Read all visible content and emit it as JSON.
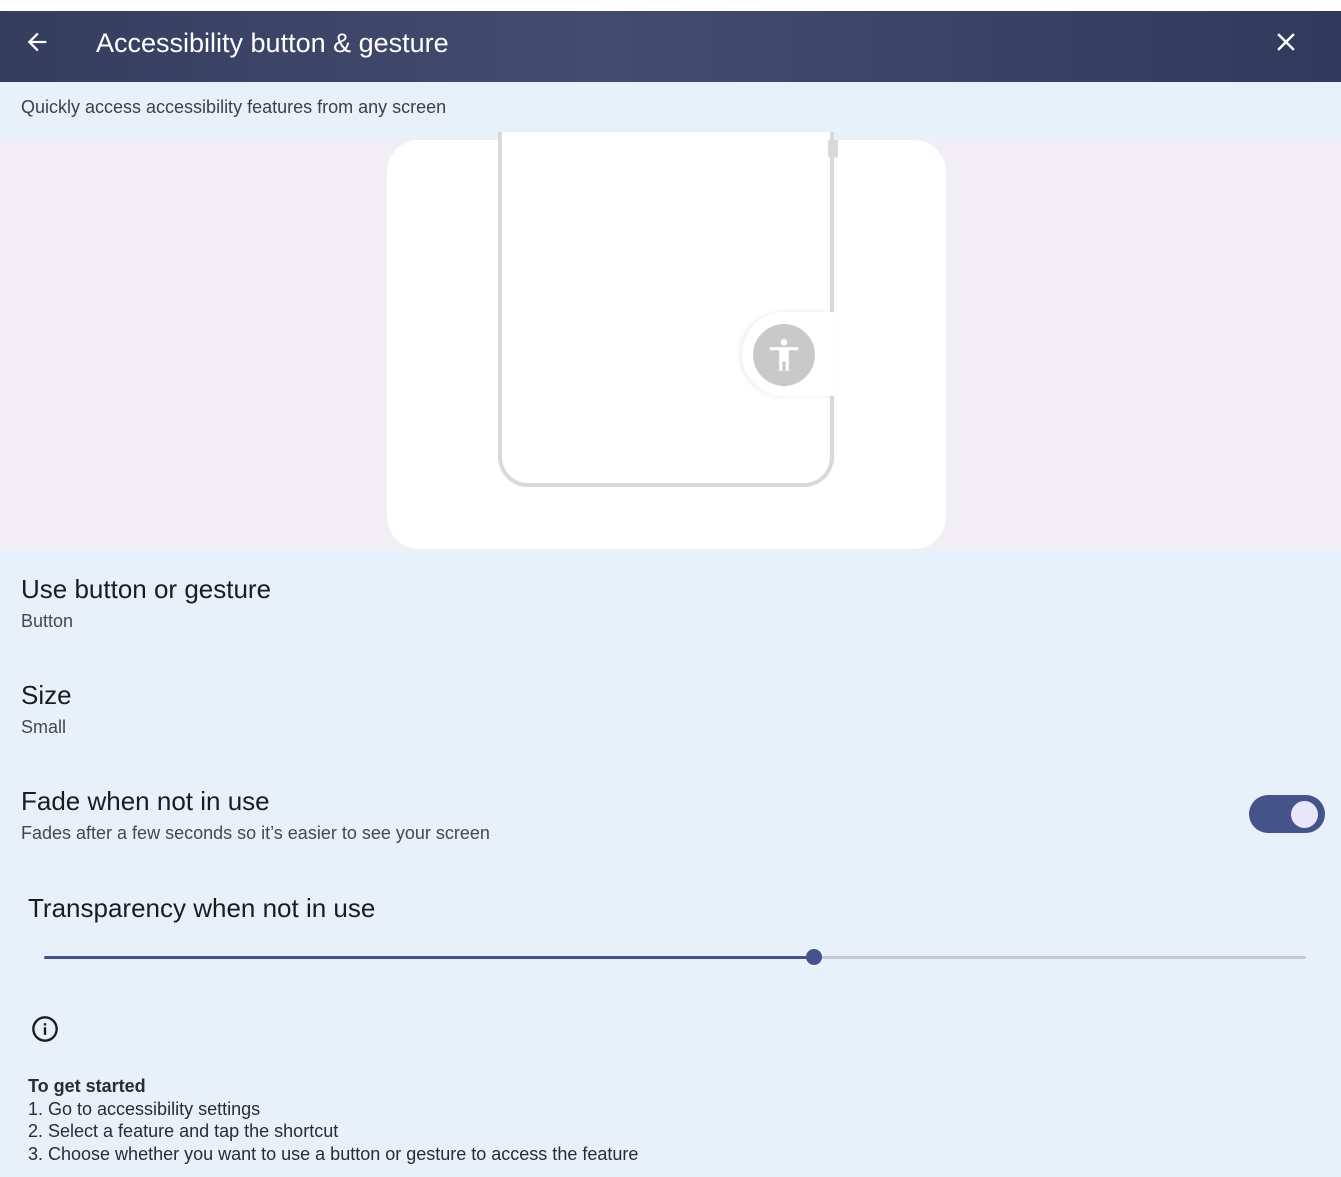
{
  "app_bar": {
    "title": "Accessibility button & gesture",
    "back_icon": "arrow-back-icon",
    "close_icon": "close-icon"
  },
  "subtitle": "Quickly access accessibility features from any screen",
  "preferences": [
    {
      "title": "Use button or gesture",
      "summary": "Button"
    },
    {
      "title": "Size",
      "summary": "Small"
    },
    {
      "title": "Fade when not in use",
      "summary": "Fades after a few seconds so it’s easier to see your screen",
      "toggle_on": true
    }
  ],
  "transparency": {
    "title": "Transparency when not in use",
    "value_fraction": 0.61
  },
  "footer": {
    "heading": "To get started",
    "steps": [
      "1. Go to accessibility settings",
      "2. Select a feature and tap the shortcut",
      "3. Choose whether you want to use a button or gesture to access the feature"
    ]
  },
  "colors": {
    "app_bar": "#3b4467",
    "background": "#e8f0f9",
    "accent": "#46528a"
  }
}
